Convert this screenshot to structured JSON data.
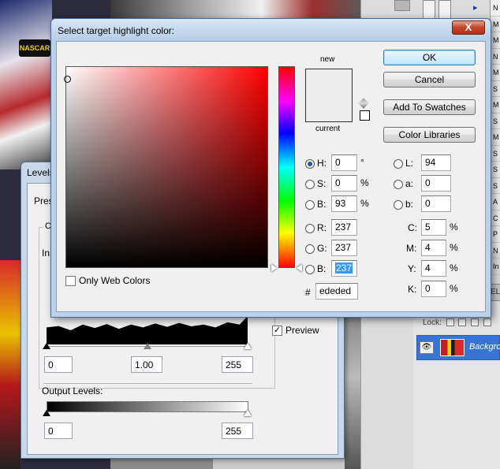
{
  "background": {
    "logo_text": "NASCAR"
  },
  "ps_panel": {
    "side_letters": [
      "N",
      "M",
      "M",
      "N",
      "M",
      "S",
      "M",
      "S",
      "M",
      "S",
      "S",
      "S",
      "A",
      "C",
      "P",
      "N",
      "In"
    ],
    "layers_header_label": "ELS",
    "lock_label": "Lock:",
    "layer_name": "Backgro"
  },
  "levels": {
    "title": "Levels",
    "preset_label": "Pres",
    "group_label": "C",
    "input_label": "In",
    "input_black": "0",
    "input_mid": "1.00",
    "input_white": "255",
    "output_label": "Output Levels:",
    "output_black": "0",
    "output_white": "255",
    "preview_label": "Preview",
    "preview_checked": true
  },
  "picker": {
    "title": "Select target highlight color:",
    "close_glyph": "X",
    "new_label": "new",
    "current_label": "current",
    "new_color": "#ededed",
    "current_color": "#ededed",
    "buttons": {
      "ok": "OK",
      "cancel": "Cancel",
      "add_swatches": "Add To Swatches",
      "color_libraries": "Color Libraries"
    },
    "hsb": {
      "h_label": "H:",
      "h_value": "0",
      "h_unit": "°",
      "s_label": "S:",
      "s_value": "0",
      "s_unit": "%",
      "b_label": "B:",
      "b_value": "93",
      "b_unit": "%"
    },
    "rgb": {
      "r_label": "R:",
      "r_value": "237",
      "g_label": "G:",
      "g_value": "237",
      "b_label": "B:",
      "b_value": "237"
    },
    "lab": {
      "l_label": "L:",
      "l_value": "94",
      "a_label": "a:",
      "a_value": "0",
      "b_label": "b:",
      "b_value": "0"
    },
    "cmyk": {
      "c_label": "C:",
      "c_value": "5",
      "m_label": "M:",
      "m_value": "4",
      "y_label": "Y:",
      "y_value": "4",
      "k_label": "K:",
      "k_value": "0",
      "unit": "%"
    },
    "hex_label": "#",
    "hex_value": "ededed",
    "only_web_colors_label": "Only Web Colors",
    "selected_mode": "H",
    "accent_color": "#3399ff"
  }
}
